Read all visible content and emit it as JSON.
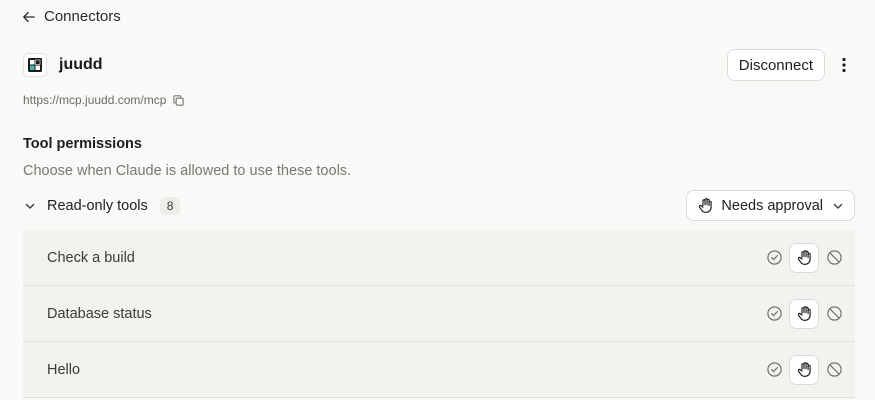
{
  "nav": {
    "back_label": "Connectors"
  },
  "connector": {
    "name": "juudd",
    "url": "https://mcp.juudd.com/mcp",
    "disconnect_label": "Disconnect"
  },
  "permissions": {
    "title": "Tool permissions",
    "subtitle": "Choose when Claude is allowed to use these tools.",
    "group": {
      "label": "Read-only tools",
      "count": "8",
      "approval_label": "Needs approval"
    },
    "tools": [
      {
        "name": "Check a build",
        "selected": "needs-approval"
      },
      {
        "name": "Database status",
        "selected": "needs-approval"
      },
      {
        "name": "Hello",
        "selected": "needs-approval"
      }
    ]
  },
  "icons": {
    "back": "arrow-left-icon",
    "logo": "juudd-logo-icon",
    "more": "more-vertical-icon",
    "copy": "copy-icon",
    "chevron": "chevron-down-icon",
    "hand": "hand-icon",
    "allow": "check-circle-icon",
    "block": "block-icon"
  },
  "colors": {
    "background": "#faf9f7",
    "row_background": "#f3f2ef",
    "logo_teal": "#3fb9b0"
  }
}
